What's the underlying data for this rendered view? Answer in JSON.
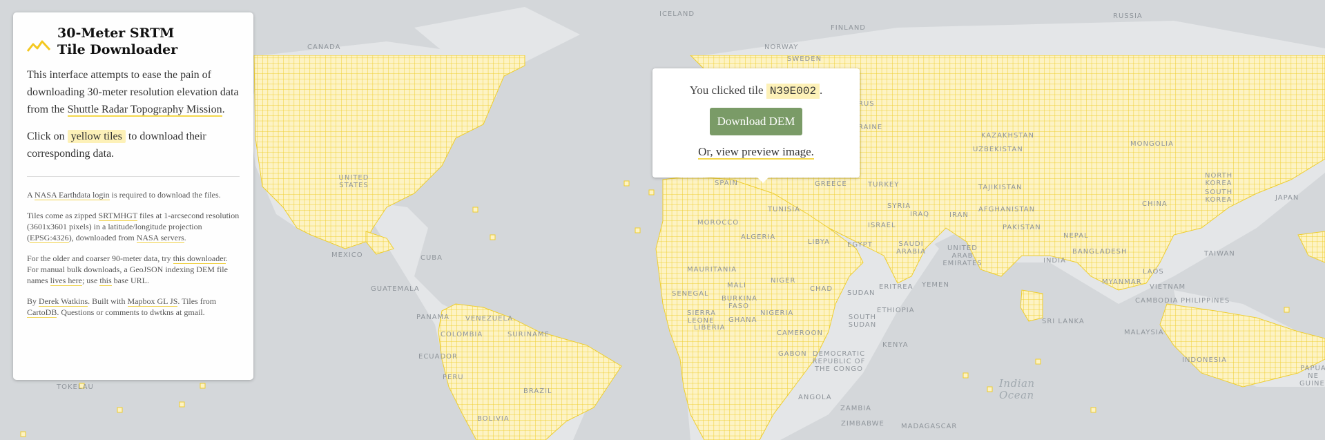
{
  "panel": {
    "title_line1": "30-Meter SRTM",
    "title_line2": "Tile Downloader",
    "intro_text": "This interface attempts to ease the pain of downloading 30-meter resolution elevation data from the ",
    "intro_link": "Shuttle Radar Topography Mission",
    "intro_end": ".",
    "click_prefix": "Click on ",
    "click_highlight": "yellow tiles",
    "click_suffix": " to download their corresponding data.",
    "p1": {
      "t1": "A ",
      "link": "NASA Earthdata login",
      "t2": " is required to download the files."
    },
    "p2": {
      "t1": "Tiles come as zipped ",
      "link1": "SRTMHGT",
      "t2": " files at 1-arcsecond resolution (3601x3601 pixels) in a latitude/longitude projection (",
      "link2": "EPSG:4326",
      "t3": "), downloaded from ",
      "link3": "NASA servers",
      "t4": "."
    },
    "p3": {
      "t1": "For the older and coarser 90-meter data, try ",
      "link1": "this downloader",
      "t2": ". For manual bulk downloads, a GeoJSON indexing DEM file names ",
      "link2": "lives here",
      "t3": "; use ",
      "link3": "this",
      "t4": " base URL."
    },
    "p4": {
      "t1": "By ",
      "link1": "Derek Watkins",
      "t2": ". Built with ",
      "link2": "Mapbox GL JS",
      "t3": ". Tiles from ",
      "link3": "CartoDB",
      "t4": ". Questions or comments to dwtkns at gmail."
    }
  },
  "popup": {
    "prefix": "You clicked tile ",
    "tile_id": "N39E002",
    "suffix": ".",
    "download_label": "Download DEM",
    "preview_label": "Or, view preview image."
  },
  "map": {
    "tile_color": "#f5d532",
    "tile_fill": "#fdf3c4",
    "land_color": "#e4e6e8",
    "water_color": "#d4d7da",
    "labels": {
      "iceland": "ICELAND",
      "finland": "FINLAND",
      "russia": "RUSSIA",
      "canada": "CANADA",
      "norway": "NORWAY",
      "sweden": "SWEDEN",
      "belarus": "RUS",
      "ukraine": "RAINE",
      "kazakhstan": "KAZAKHSTAN",
      "mongolia": "MONGOLIA",
      "uzbekistan": "UZBEKISTAN",
      "tajikistan": "TAJIKISTAN",
      "united_states": "UNITED STATES",
      "spain": "SPAIN",
      "greece": "GREECE",
      "turkey": "TURKEY",
      "north_korea": "NORTH KOREA",
      "south_korea": "SOUTH KOREA",
      "japan": "JAPAN",
      "china": "CHINA",
      "syria": "SYRIA",
      "afghanistan": "AFGHANISTAN",
      "tunisia": "TUNISIA",
      "iraq": "IRAQ",
      "iran": "IRAN",
      "morocco": "MOROCCO",
      "israel": "ISRAEL",
      "pakistan": "PAKISTAN",
      "nepal": "NEPAL",
      "algeria": "ALGERIA",
      "libya": "LIBYA",
      "egypt": "EGYPT",
      "saudi_arabia": "SAUDI ARABIA",
      "mexico": "MEXICO",
      "cuba": "CUBA",
      "uae": "UNITED ARAB EMIRATES",
      "india": "INDIA",
      "bangladesh": "BANGLADESH",
      "taiwan": "TAIWAN",
      "mauritania": "MAURITANIA",
      "niger": "NIGER",
      "mali": "MALI",
      "myanmar": "MYANMAR",
      "laos": "LAOS",
      "guatemala": "GUATEMALA",
      "chad": "CHAD",
      "sudan": "SUDAN",
      "eritrea": "ERITREA",
      "yemen": "YEMEN",
      "vietnam": "VIETNAM",
      "senegal": "SENEGAL",
      "burkina_faso": "BURKINA FASO",
      "philippines": "PHILIPPINES",
      "cambodia": "CAMBODIA",
      "sierra_leone": "SIERRA LEONE",
      "nigeria": "NIGERIA",
      "ethiopia": "ETHIOPIA",
      "panama": "PANAMA",
      "venezuela": "VENEZUELA",
      "liberia": "LIBERIA",
      "ghana": "GHANA",
      "south_sudan": "SOUTH SUDAN",
      "sri_lanka": "SRI LANKA",
      "colombia": "COLOMBIA",
      "suriname": "SURINAME",
      "cameroon": "CAMEROON",
      "malaysia": "MALAYSIA",
      "kenya": "KENYA",
      "ecuador": "ECUADOR",
      "gabon": "GABON",
      "drc": "DEMOCRATIC REPUBLIC OF THE CONGO",
      "indonesia": "INDONESIA",
      "papua": "PAPUA NE GUINEA",
      "peru": "PERU",
      "tokelau": "TOKELAU",
      "brazil": "BRAZIL",
      "indian_ocean": "Indian Ocean",
      "angola": "ANGOLA",
      "zambia": "ZAMBIA",
      "bolivia": "BOLIVIA",
      "zimbabwe": "ZIMBABWE",
      "madagascar": "MADAGASCAR"
    }
  }
}
